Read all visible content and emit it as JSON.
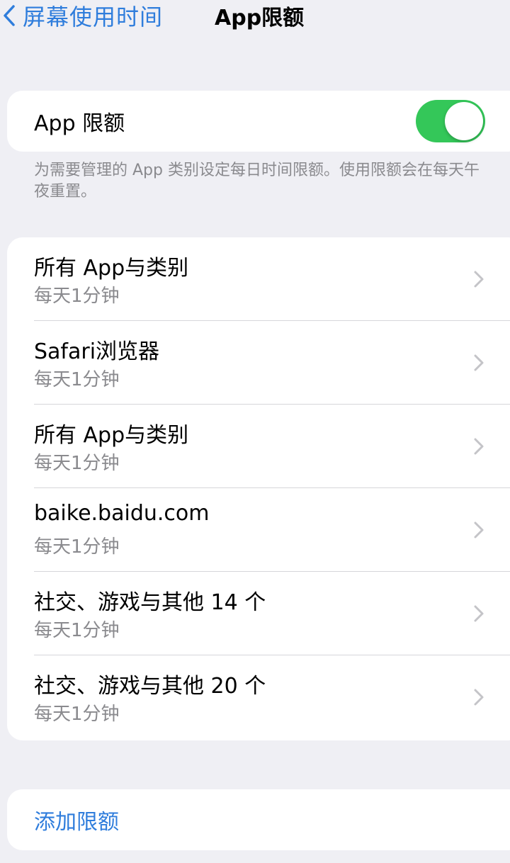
{
  "nav": {
    "back_label": "屏幕使用时间",
    "title": "App限额"
  },
  "app_limits": {
    "toggle_label": "App 限额",
    "toggle_on": true,
    "footnote": "为需要管理的 App 类别设定每日时间限额。使用限额会在每天午夜重置。"
  },
  "limits": [
    {
      "title": "所有 App与类别",
      "subtitle": "每天1分钟"
    },
    {
      "title": "Safari浏览器",
      "subtitle": "每天1分钟"
    },
    {
      "title": "所有 App与类别",
      "subtitle": "每天1分钟"
    },
    {
      "title": "baike.baidu.com",
      "subtitle": "每天1分钟"
    },
    {
      "title": "社交、游戏与其他 14 个",
      "subtitle": "每天1分钟"
    },
    {
      "title": "社交、游戏与其他 20 个",
      "subtitle": "每天1分钟"
    }
  ],
  "add_limit": {
    "label": "添加限额"
  },
  "colors": {
    "accent": "#2f7ddc",
    "switch_on": "#34c759",
    "background": "#efeff4",
    "secondary_text": "#8a8a8e"
  },
  "icons": {
    "back": "chevron-left-icon",
    "row": "chevron-right-icon"
  }
}
